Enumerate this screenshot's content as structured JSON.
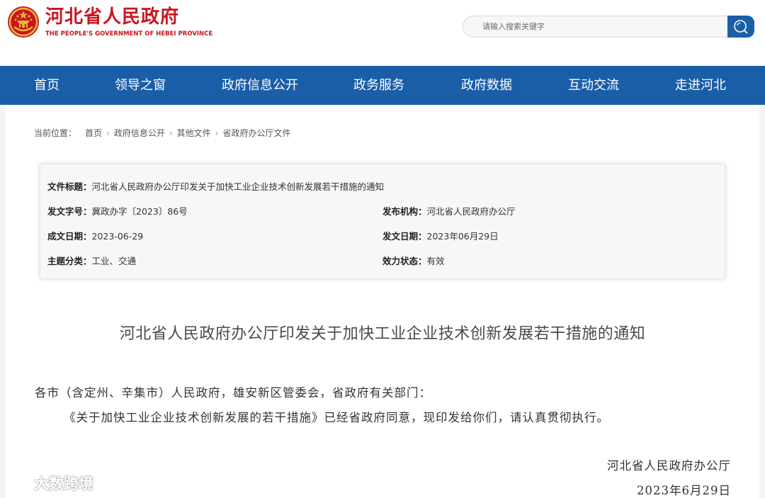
{
  "header": {
    "logo_cn": "河北省人民政府",
    "logo_en": "THE PEOPLE'S GOVERNMENT OF HEBEI PROVINCE",
    "search_placeholder": "请输入搜索关键字"
  },
  "nav": {
    "items": [
      "首页",
      "领导之窗",
      "政府信息公开",
      "政务服务",
      "政府数据",
      "互动交流",
      "走进河北"
    ]
  },
  "breadcrumb": {
    "prefix": "当前位置：",
    "items": [
      "首页",
      "政府信息公开",
      "其他文件",
      "省政府办公厅文件"
    ]
  },
  "info": {
    "title_label": "文件标题：",
    "title_value": "河北省人民政府办公厅印发关于加快工业企业技术创新发展若干措施的通知",
    "doc_no_label": "发文字号：",
    "doc_no_value": "冀政办字〔2023〕86号",
    "issuer_label": "发布机构：",
    "issuer_value": "河北省人民政府办公厅",
    "written_date_label": "成文日期：",
    "written_date_value": "2023-06-29",
    "publish_date_label": "发文日期：",
    "publish_date_value": "2023年06月29日",
    "category_label": "主题分类：",
    "category_value": "工业、交通",
    "status_label": "效力状态：",
    "status_value": "有效"
  },
  "document": {
    "title": "河北省人民政府办公厅印发关于加快工业企业技术创新发展若干措施的通知",
    "salutation": "各市（含定州、辛集市）人民政府，雄安新区管委会，省政府有关部门：",
    "paragraph": "《关于加快工业企业技术创新发展的若干措施》已经省政府同意，现印发给你们，请认真贯彻执行。",
    "signature": "河北省人民政府办公厅",
    "date": "2023年6月29日"
  },
  "watermark": {
    "text": "大数跨境"
  },
  "colors": {
    "nav_blue": "#1b5ea8",
    "brand_red": "#c8161d",
    "emblem_gold": "#e8b53a"
  }
}
